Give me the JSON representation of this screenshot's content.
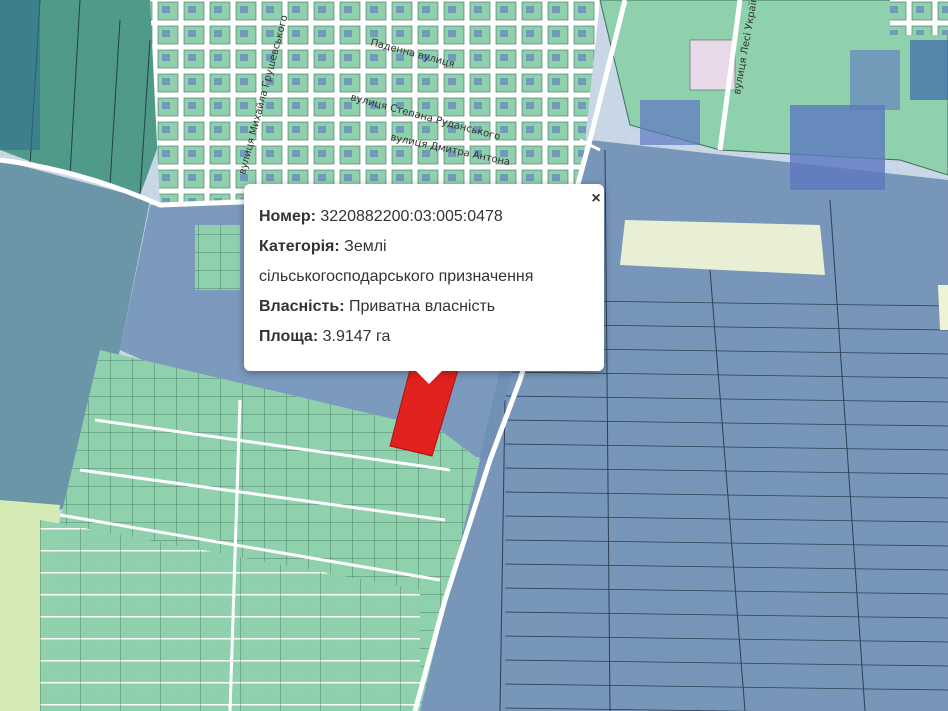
{
  "popup": {
    "number_label": "Номер:",
    "number_value": "3220882200:03:005:0478",
    "category_label": "Категорія:",
    "category_value_line1": "Землі",
    "category_value_line2": "сільськогосподарського призначення",
    "ownership_label": "Власність:",
    "ownership_value": "Приватна власність",
    "area_label": "Площа:",
    "area_value": "3.9147 га",
    "close_symbol": "×"
  },
  "map": {
    "street_labels": [
      "Паденна вулиця",
      "вулиця Степана Руданського",
      "вулиця Дмитра Антона",
      "вулиця Михайла Грушевського",
      "вулиця Лесі Українки"
    ],
    "colors": {
      "agricultural": "#6e8fb5",
      "residential": "#8fd0ad",
      "residential_dark": "#4f9a88",
      "road": "#ffffff",
      "selected_parcel": "#e0211d",
      "industrial": "#5d78c0",
      "pale": "#eef3d6",
      "grass": "#d5ebb6"
    }
  }
}
